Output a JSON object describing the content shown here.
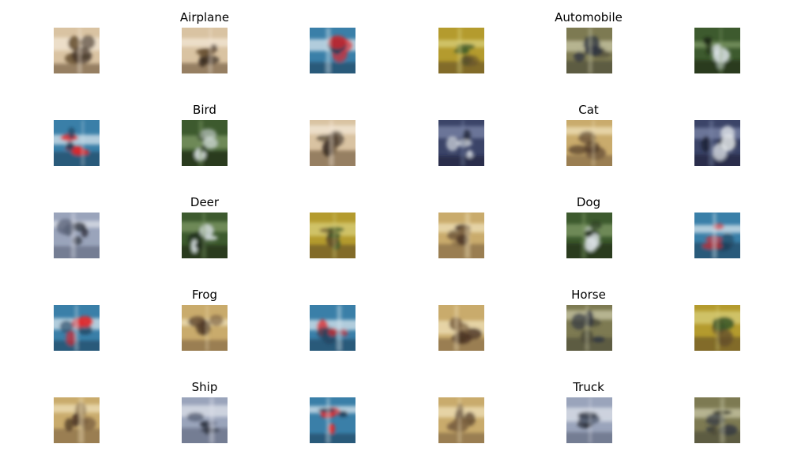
{
  "titles": [
    "Airplane",
    "Automobile",
    "Bird",
    "Cat",
    "Deer",
    "Dog",
    "Frog",
    "Horse",
    "Ship",
    "Truck"
  ],
  "palettes": {
    "blue_red": {
      "bg": "#3a7fa8",
      "accent": "#e0262a",
      "dark": "#1d3f5a",
      "light": "#d8e6ee"
    },
    "beige_dark": {
      "bg": "#d9c3a2",
      "accent": "#3a2c22",
      "dark": "#6b5436",
      "light": "#f3e7d6"
    },
    "yellow_green": {
      "bg": "#b49b2e",
      "accent": "#3f5a2a",
      "dark": "#5f4c2a",
      "light": "#d8cf7a"
    },
    "navy_white": {
      "bg": "#3b4468",
      "accent": "#e8ecef",
      "dark": "#1c2235",
      "light": "#7b86a8"
    },
    "green_white": {
      "bg": "#3d5a2e",
      "accent": "#d8dfe2",
      "dark": "#1c2a18",
      "light": "#7f9a66"
    },
    "tan_dark": {
      "bg": "#c9ab6c",
      "accent": "#4a3424",
      "dark": "#7a6040",
      "light": "#efe0b8"
    },
    "grey_blue": {
      "bg": "#9aa4bb",
      "accent": "#2a2f3a",
      "dark": "#5a6378",
      "light": "#dde1ea"
    },
    "olive_grey": {
      "bg": "#7d7a52",
      "accent": "#2d3340",
      "dark": "#4a4836",
      "light": "#c8c7a6"
    }
  },
  "grid": [
    [
      "beige_dark",
      "beige_dark",
      "blue_red",
      "yellow_green",
      "olive_grey",
      "green_white"
    ],
    [
      "blue_red",
      "green_white",
      "beige_dark",
      "navy_white",
      "tan_dark",
      "navy_white"
    ],
    [
      "grey_blue",
      "green_white",
      "yellow_green",
      "tan_dark",
      "green_white",
      "blue_red"
    ],
    [
      "blue_red",
      "tan_dark",
      "blue_red",
      "tan_dark",
      "olive_grey",
      "yellow_green"
    ],
    [
      "tan_dark",
      "grey_blue",
      "blue_red",
      "tan_dark",
      "grey_blue",
      "olive_grey"
    ]
  ]
}
